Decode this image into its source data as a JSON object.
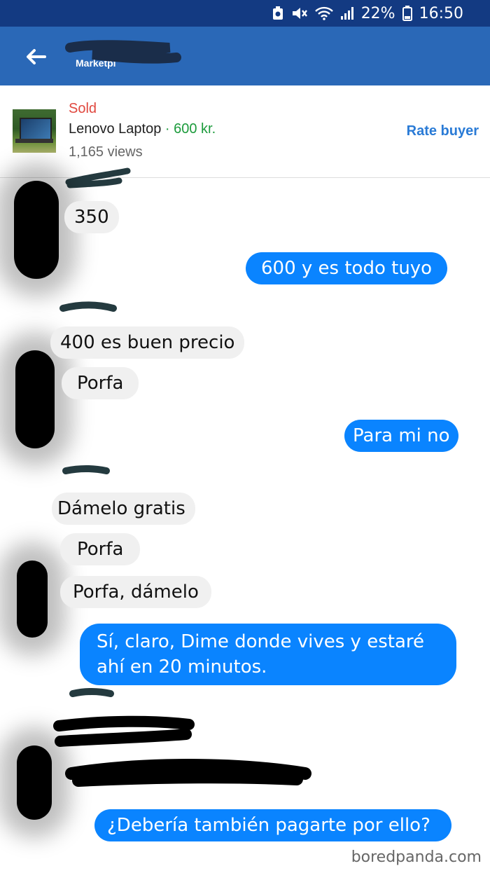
{
  "status_bar": {
    "battery": "22%",
    "time": "16:50"
  },
  "app_bar": {
    "subtitle": "Marketpl"
  },
  "listing": {
    "status": "Sold",
    "title": "Lenovo Laptop",
    "separator": " · ",
    "price": "600 kr.",
    "views": "1,165 views",
    "rate_label": "Rate buyer"
  },
  "messages": [
    {
      "side": "in",
      "text": "350"
    },
    {
      "side": "out",
      "text": "600 y es todo tuyo"
    },
    {
      "side": "in",
      "text": "400 es buen precio"
    },
    {
      "side": "in",
      "text": "Porfa"
    },
    {
      "side": "out",
      "text": "Para mi no"
    },
    {
      "side": "in",
      "text": "Dámelo gratis"
    },
    {
      "side": "in",
      "text": "Porfa"
    },
    {
      "side": "in",
      "text": "Porfa, dámelo"
    },
    {
      "side": "out",
      "text": "Sí, claro, Dime donde vives y estaré ahí en 20 minutos."
    },
    {
      "side": "out",
      "text": "¿Debería también pagarte por ello?"
    }
  ],
  "watermark": "boredpanda.com",
  "colors": {
    "status_bar": "#133a82",
    "app_bar": "#2a68b7",
    "outgoing": "#0a84ff",
    "incoming": "#f0f0f0",
    "sold": "#e0473e",
    "price": "#1c9b3c",
    "rate": "#2a7bd6"
  },
  "icons": [
    "back-arrow-icon",
    "battery-icon",
    "wifi-icon",
    "signal-icon",
    "mute-icon",
    "data-saver-icon"
  ]
}
